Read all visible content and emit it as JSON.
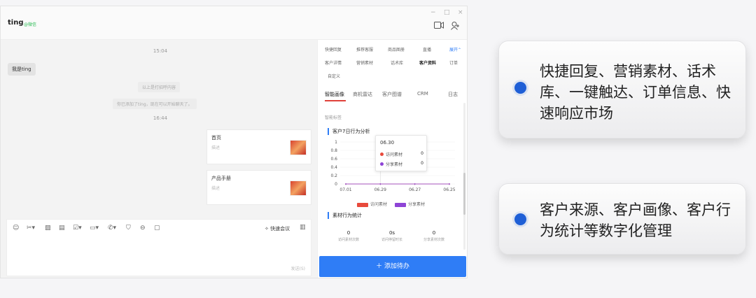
{
  "app": {
    "name": "ting",
    "wechat_tag": "@微信",
    "win_controls": [
      "−",
      "□",
      "×"
    ]
  },
  "chat": {
    "time1": "15:04",
    "my_bubble": "我是ting",
    "sys_msg1": "以上是打招呼内容",
    "sys_msg2": "你已添加了ting，现在可以开始聊天了。",
    "time2": "16:44",
    "cards": [
      {
        "title": "首页",
        "subtitle": "描述"
      },
      {
        "title": "产品手册",
        "subtitle": "描述"
      }
    ]
  },
  "input": {
    "meeting": "快速会议",
    "send_hint": "发送(S)"
  },
  "side": {
    "tool_tags_row1": [
      "快捷回复",
      "推荐客服",
      "商品图册",
      "直播",
      "展开"
    ],
    "tool_tags_row2": [
      "客户详情",
      "营销素材",
      "话术库",
      "客户资料",
      "订单"
    ],
    "tool_tags_row3": [
      "自定义"
    ],
    "profile_tabs": [
      "智能画像",
      "商机雷达",
      "客户图谱",
      "CRM",
      "日志"
    ],
    "smart_label": "智能标签",
    "behavior_title": "客户7日行为分析",
    "tooltip": {
      "date": "06.30",
      "rows": [
        {
          "label": "访问素材",
          "value": "0",
          "color": "#e84a3c"
        },
        {
          "label": "分享素材",
          "value": "0",
          "color": "#8e44d6"
        }
      ]
    },
    "legend": [
      {
        "label": "访问素材",
        "color": "#e84a3c"
      },
      {
        "label": "分享素材",
        "color": "#8e44d6"
      }
    ],
    "stats_title": "素材行为统计",
    "stats": [
      {
        "value": "0",
        "label": "访问素材次数"
      },
      {
        "value": "0s",
        "label": "访问停留时长"
      },
      {
        "value": "0",
        "label": "分享素材次数"
      }
    ],
    "add_button": "＋ 添加待办"
  },
  "chart_data": {
    "type": "line",
    "categories": [
      "07.01",
      "06.29",
      "06.27",
      "06.25"
    ],
    "series": [
      {
        "name": "访问素材",
        "values": [
          0,
          0,
          0,
          0
        ]
      },
      {
        "name": "分享素材",
        "values": [
          0,
          0,
          0,
          0
        ]
      }
    ],
    "y_ticks": [
      "1",
      "0.8",
      "0.6",
      "0.4",
      "0.2",
      "0"
    ],
    "ylim": [
      0,
      1
    ],
    "legend_position": "bottom"
  },
  "callouts": [
    {
      "text": "快捷回复、营销素材、话术库、一键触达、订单信息、快速响应市场"
    },
    {
      "text": "客户来源、客户画像、客户行为统计等数字化管理"
    }
  ]
}
